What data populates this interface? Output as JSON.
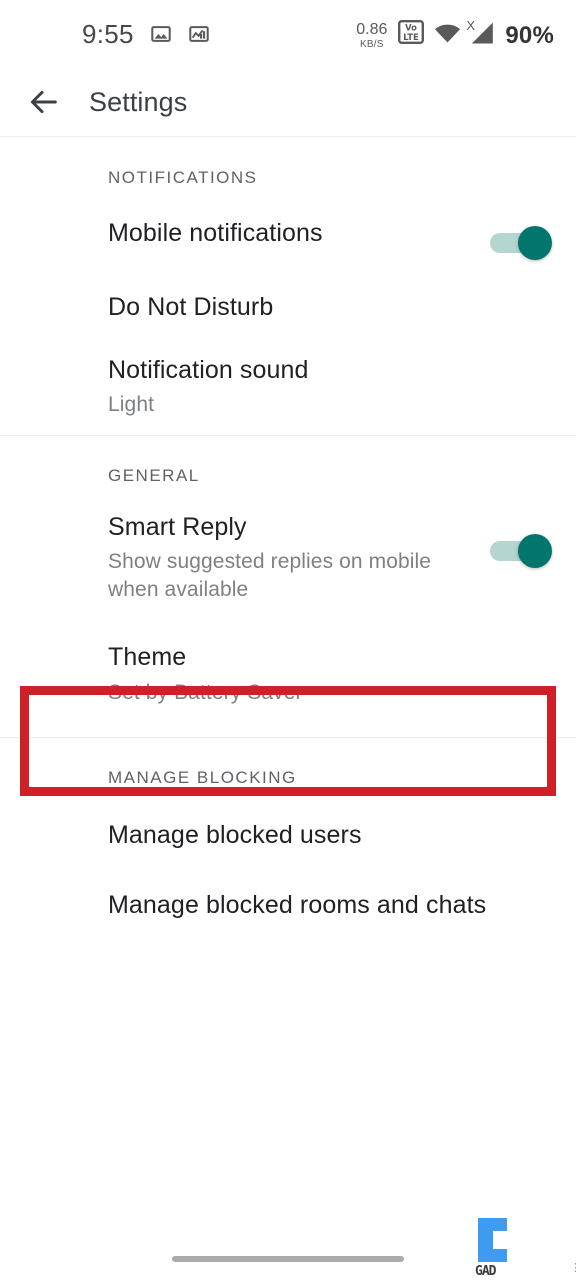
{
  "status_bar": {
    "time": "9:55",
    "icons_left": [
      "image-icon",
      "stocks-chart-icon"
    ],
    "net_speed_value": "0.86",
    "net_speed_unit": "KB/S",
    "volte_label_top": "Vo",
    "volte_label_sup": "LTE",
    "volte_text": "VoLTE",
    "wifi_icon": "wifi-icon",
    "signal_icon": "signal-bars-icon",
    "signal_badge": "X",
    "battery": "90%"
  },
  "app_bar": {
    "back_icon": "back-arrow-icon",
    "title": "Settings"
  },
  "sections": [
    {
      "header": "NOTIFICATIONS",
      "rows": [
        {
          "title": "Mobile notifications",
          "subtitle": "",
          "control": "toggle",
          "toggle_on": true
        },
        {
          "title": "Do Not Disturb",
          "subtitle": "",
          "control": "none",
          "toggle_on": false
        },
        {
          "title": "Notification sound",
          "subtitle": "Light",
          "control": "none",
          "toggle_on": false
        }
      ]
    },
    {
      "header": "GENERAL",
      "rows": [
        {
          "title": "Smart Reply",
          "subtitle": "Show suggested replies on mobile when available",
          "control": "toggle",
          "toggle_on": true
        },
        {
          "title": "Theme",
          "subtitle": "Set by Battery Saver",
          "control": "none",
          "toggle_on": false,
          "highlighted": true
        }
      ]
    },
    {
      "header": "MANAGE BLOCKING",
      "rows": [
        {
          "title": "Manage blocked users",
          "subtitle": "",
          "control": "none",
          "toggle_on": false
        },
        {
          "title": "Manage blocked rooms and chats",
          "subtitle": "",
          "control": "none",
          "toggle_on": false
        }
      ]
    }
  ],
  "annotation": {
    "type": "rectangle-highlight",
    "color": "#cf2027",
    "target": "Theme"
  },
  "watermark": {
    "text": "GAD",
    "color": "#3e9bf0"
  },
  "colors": {
    "toggle_on_knob": "#02766c",
    "toggle_on_track": "#b5d5d0",
    "title_text": "#202124",
    "subtitle_text": "#7e8184",
    "section_header_text": "#5f6368",
    "divider": "#ededee",
    "annotation_red": "#cf2027",
    "background": "#ffffff"
  },
  "nav_bar": {
    "gesture_pill": "home-gesture-pill"
  }
}
